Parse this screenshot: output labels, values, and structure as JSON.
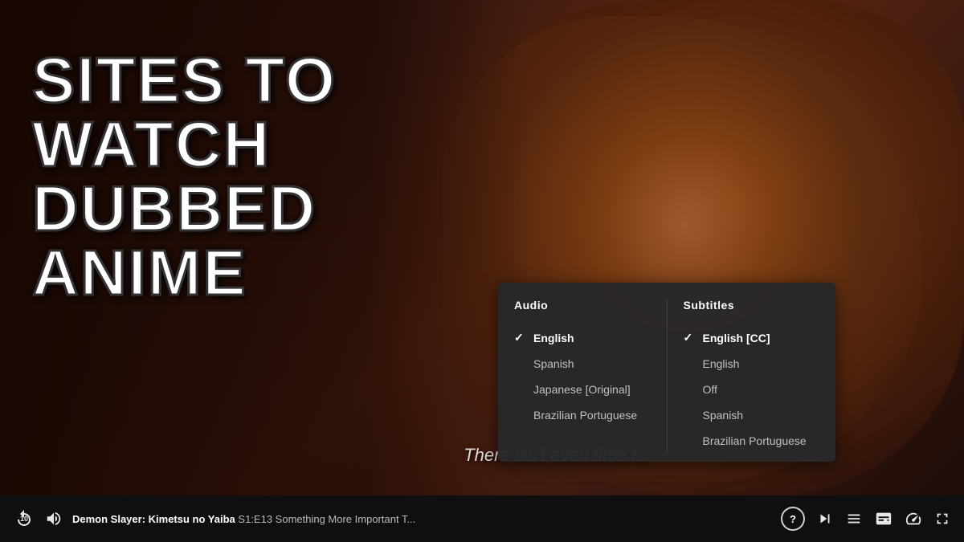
{
  "title": {
    "line1": "SITES TO",
    "line2": "WATCH",
    "line3": "DUBBED",
    "line4": "ANIME"
  },
  "video_subtitle": "There isn't even time to",
  "lang_panel": {
    "audio_header": "Audio",
    "subtitles_header": "Subtitles",
    "audio_options": [
      {
        "label": "English",
        "selected": true
      },
      {
        "label": "Spanish",
        "selected": false
      },
      {
        "label": "Japanese [Original]",
        "selected": false
      },
      {
        "label": "Brazilian Portuguese",
        "selected": false
      }
    ],
    "subtitle_options": [
      {
        "label": "English [CC]",
        "selected": true
      },
      {
        "label": "English",
        "selected": false
      },
      {
        "label": "Off",
        "selected": false
      },
      {
        "label": "Spanish",
        "selected": false
      },
      {
        "label": "Brazilian Portuguese",
        "selected": false
      }
    ]
  },
  "controls": {
    "show_title": "Demon Slayer: Kimetsu no Yaiba",
    "episode_info": "S1:E13  Something More Important T...",
    "time_display": "10",
    "help_label": "?",
    "volume_icon": "🔊",
    "replay_icon": "↺",
    "skip_forward_icon": "⏭",
    "queue_icon": "☰",
    "subtitles_icon": "⊡",
    "speed_icon": "⏱",
    "fullscreen_icon": "⤢"
  }
}
